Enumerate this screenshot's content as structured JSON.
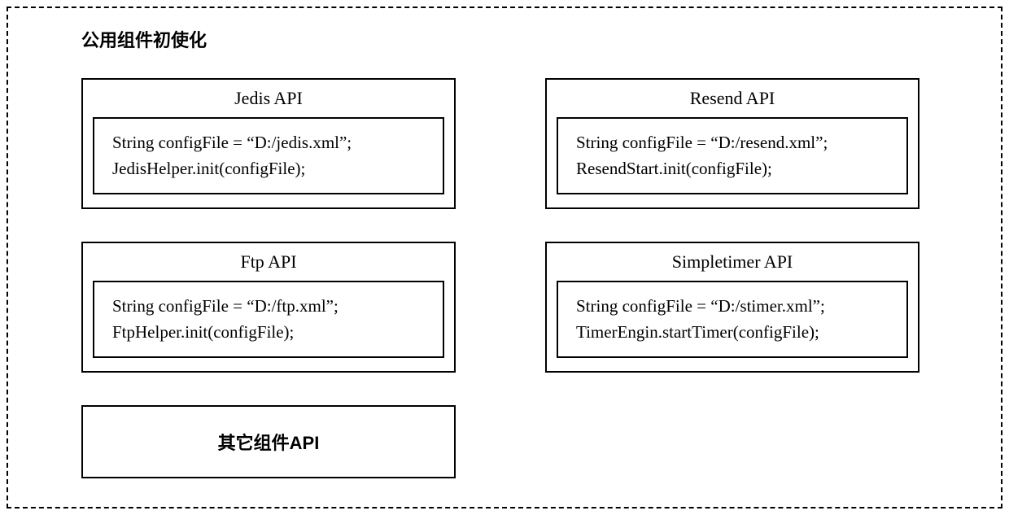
{
  "title": "公用组件初使化",
  "apis": [
    {
      "name": "Jedis API",
      "code": "String configFile = “D:/jedis.xml”;\nJedisHelper.init(configFile);"
    },
    {
      "name": "Resend API",
      "code": "String configFile = “D:/resend.xml”;\nResendStart.init(configFile);"
    },
    {
      "name": "Ftp API",
      "code": "String configFile = “D:/ftp.xml”;\nFtpHelper.init(configFile);"
    },
    {
      "name": "Simpletimer API",
      "code": "String configFile = “D:/stimer.xml”;\nTimerEngin.startTimer(configFile);"
    }
  ],
  "other_label": "其它组件API"
}
